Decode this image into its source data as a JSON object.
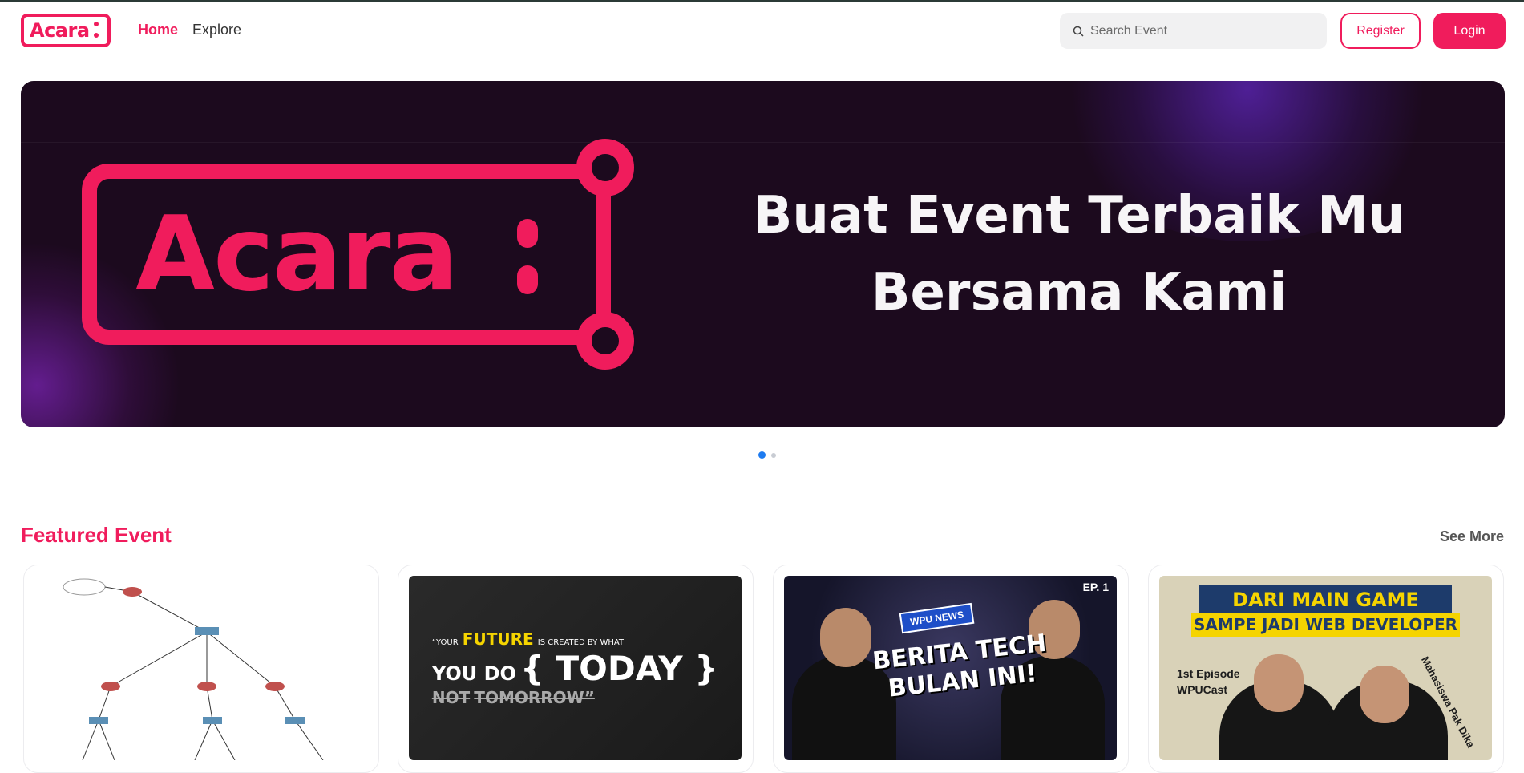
{
  "brand": {
    "name": "Acara",
    "accent": "#f01c5c"
  },
  "nav": {
    "home": "Home",
    "explore": "Explore"
  },
  "search": {
    "placeholder": "Search Event"
  },
  "auth": {
    "register": "Register",
    "login": "Login"
  },
  "hero": {
    "logo_text": "Acara",
    "line1": "Buat Event Terbaik Mu",
    "line2": "Bersama Kami",
    "slides": 2,
    "active_slide": 1
  },
  "featured": {
    "title": "Featured Event",
    "see_more": "See More",
    "cards": [
      {
        "image": "network-topology-diagram"
      },
      {
        "image": "quote-poster",
        "q_open": "“YOUR",
        "q_future": "FUTURE",
        "q_rest": "IS CREATED BY WHAT",
        "q_youdo": "YOU DO",
        "q_today": "{ TODAY }",
        "q_not": "NOT",
        "q_tomorrow": "TOMORROW”"
      },
      {
        "image": "wpu-news-thumbnail",
        "ep": "EP. 1",
        "tag": "WPU NEWS",
        "headline1": "BERITA TECH",
        "headline2": "BULAN INI!"
      },
      {
        "image": "wpucast-thumbnail",
        "top": "DARI MAIN GAME",
        "mid": "SAMPE JADI WEB DEVELOPER",
        "ep1": "1st Episode",
        "ep2": "WPUCast",
        "side": "Mahasiswa Pak Dika"
      }
    ]
  }
}
